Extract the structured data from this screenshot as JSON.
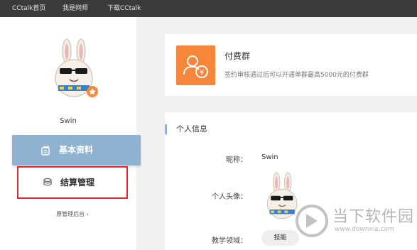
{
  "topbar": {
    "items": [
      {
        "label": "CCtalk首页"
      },
      {
        "label": "我是网师"
      },
      {
        "label": "下载CCtalk"
      }
    ]
  },
  "sidebar": {
    "username": "Swin",
    "menu": {
      "basic_info": {
        "label": "基本资料",
        "icon": "profile-card-icon"
      },
      "settlement": {
        "label": "结算管理",
        "icon": "coins-stack-icon"
      }
    },
    "old_admin_link": "原管理后台 ›"
  },
  "paid_group": {
    "title": "付费群",
    "description": "签约审核通过后可以开通单群最高5000元的付费群",
    "icon": "paid-group-icon",
    "icon_color": "#f6863a"
  },
  "personal_info": {
    "title": "个人信息",
    "nickname_label": "昵称：",
    "nickname_value": "Swin",
    "avatar_label": "个人头像：",
    "field_label": "教学领域：",
    "field_tag": "技能"
  },
  "watermark": {
    "text": "当下软件园",
    "url": "www.downxia.com"
  },
  "colors": {
    "topbar": "#3a3a3a",
    "accent_blue": "#8eb2d0",
    "highlight_red": "#e8262b",
    "orange": "#f6863a"
  }
}
